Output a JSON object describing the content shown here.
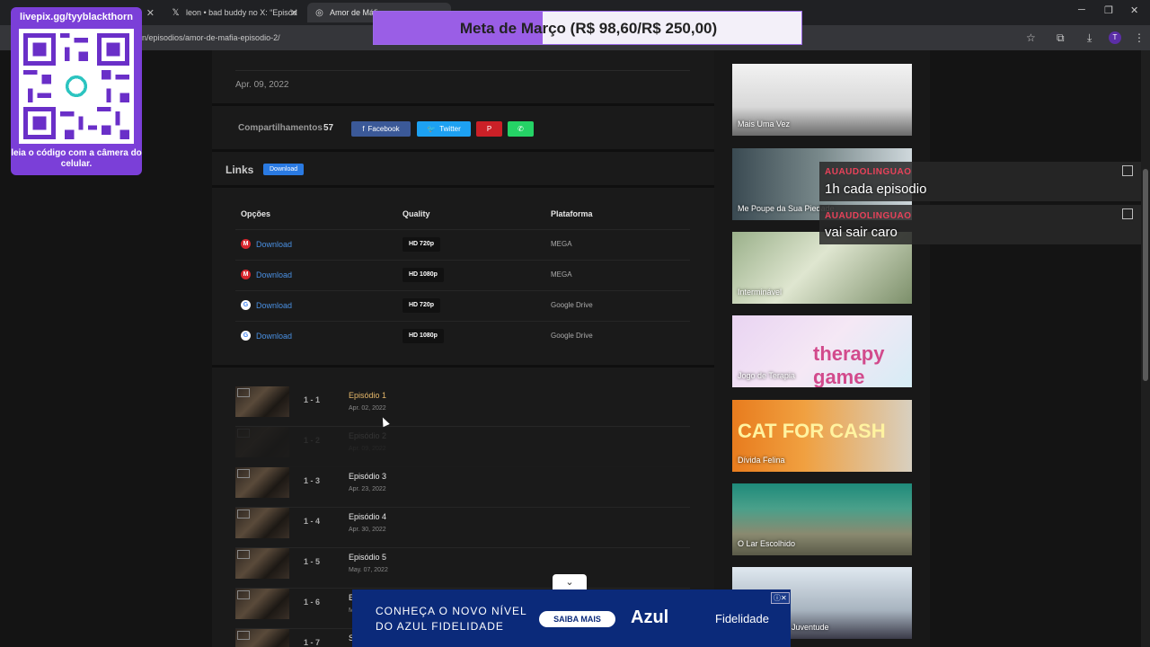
{
  "browser": {
    "tabs": [
      {
        "label": "",
        "icon": "livepix-icon"
      },
      {
        "label": "leon • bad buddy no X: “Episód",
        "icon": "x-logo-icon"
      },
      {
        "label": "Amor de Máfi",
        "icon": "site-icon"
      }
    ],
    "url": "n/episodios/amor-de-mafia-episodio-2/",
    "profile_initial": "T"
  },
  "post": {
    "date": "Apr. 09, 2022",
    "share_label": "Compartilhamentos",
    "share_count": "57",
    "share_buttons": {
      "facebook": "Facebook",
      "twitter": "Twitter"
    }
  },
  "links": {
    "title": "Links",
    "badge": "Download",
    "headers": {
      "options": "Opções",
      "quality": "Quality",
      "platform": "Plataforma"
    },
    "rows": [
      {
        "link": "Download",
        "quality": "HD 720p",
        "platform": "MEGA",
        "icon": "mega-icon"
      },
      {
        "link": "Download",
        "quality": "HD 1080p",
        "platform": "MEGA",
        "icon": "mega-icon"
      },
      {
        "link": "Download",
        "quality": "HD 720p",
        "platform": "Google Drive",
        "icon": "google-icon"
      },
      {
        "link": "Download",
        "quality": "HD 1080p",
        "platform": "Google Drive",
        "icon": "google-icon"
      }
    ]
  },
  "episodes": [
    {
      "num": "1 - 1",
      "title": "Episódio 1",
      "date": "Apr. 02, 2022"
    },
    {
      "num": "1 - 2",
      "title": "Episódio 2",
      "date": "Apr. 09, 2022"
    },
    {
      "num": "1 - 3",
      "title": "Episódio 3",
      "date": "Apr. 23, 2022"
    },
    {
      "num": "1 - 4",
      "title": "Episódio 4",
      "date": "Apr. 30, 2022"
    },
    {
      "num": "1 - 5",
      "title": "Episódio 5",
      "date": "May. 07, 2022"
    },
    {
      "num": "1 - 6",
      "title": "E",
      "date": "M"
    },
    {
      "num": "1 - 7",
      "title": "S",
      "date": ""
    }
  ],
  "sidebar": {
    "cards": [
      {
        "caption": "Mais Uma Vez"
      },
      {
        "caption": "Me Poupe da Sua Piedade"
      },
      {
        "caption": "Interminável"
      },
      {
        "caption": "Jogo de Terapia",
        "overlay": "therapy game"
      },
      {
        "caption": "Dívida Felina",
        "overlay": "CAT FOR CASH"
      },
      {
        "caption": "O Lar Escolhido"
      },
      {
        "caption": "Juventude"
      }
    ]
  },
  "overlay": {
    "qr_header": "livepix.gg/tyyblackthorn",
    "qr_footer": "leia o código com a câmera do celular.",
    "goal_text": "Meta de Março (R$ 98,60/R$ 250,00)",
    "goal_progress": 0.394,
    "chat": [
      {
        "user": "AUAUDOLINGUAO",
        "message": "1h cada episodio"
      },
      {
        "user": "AUAUDOLINGUAO",
        "message": "vai sair caro"
      }
    ]
  },
  "ad": {
    "message_line1": "CONHEÇA O NOVO NÍVEL",
    "message_line2": "DO AZUL FIDELIDADE",
    "button": "SAIBA MAIS",
    "brand": "Azul",
    "brand_sub": "Fidelidade"
  },
  "colors": {
    "accent": "#9a5ee6",
    "link": "#4a90e2",
    "current_episode": "#e6b86a",
    "chat_user": "#e8425a"
  }
}
